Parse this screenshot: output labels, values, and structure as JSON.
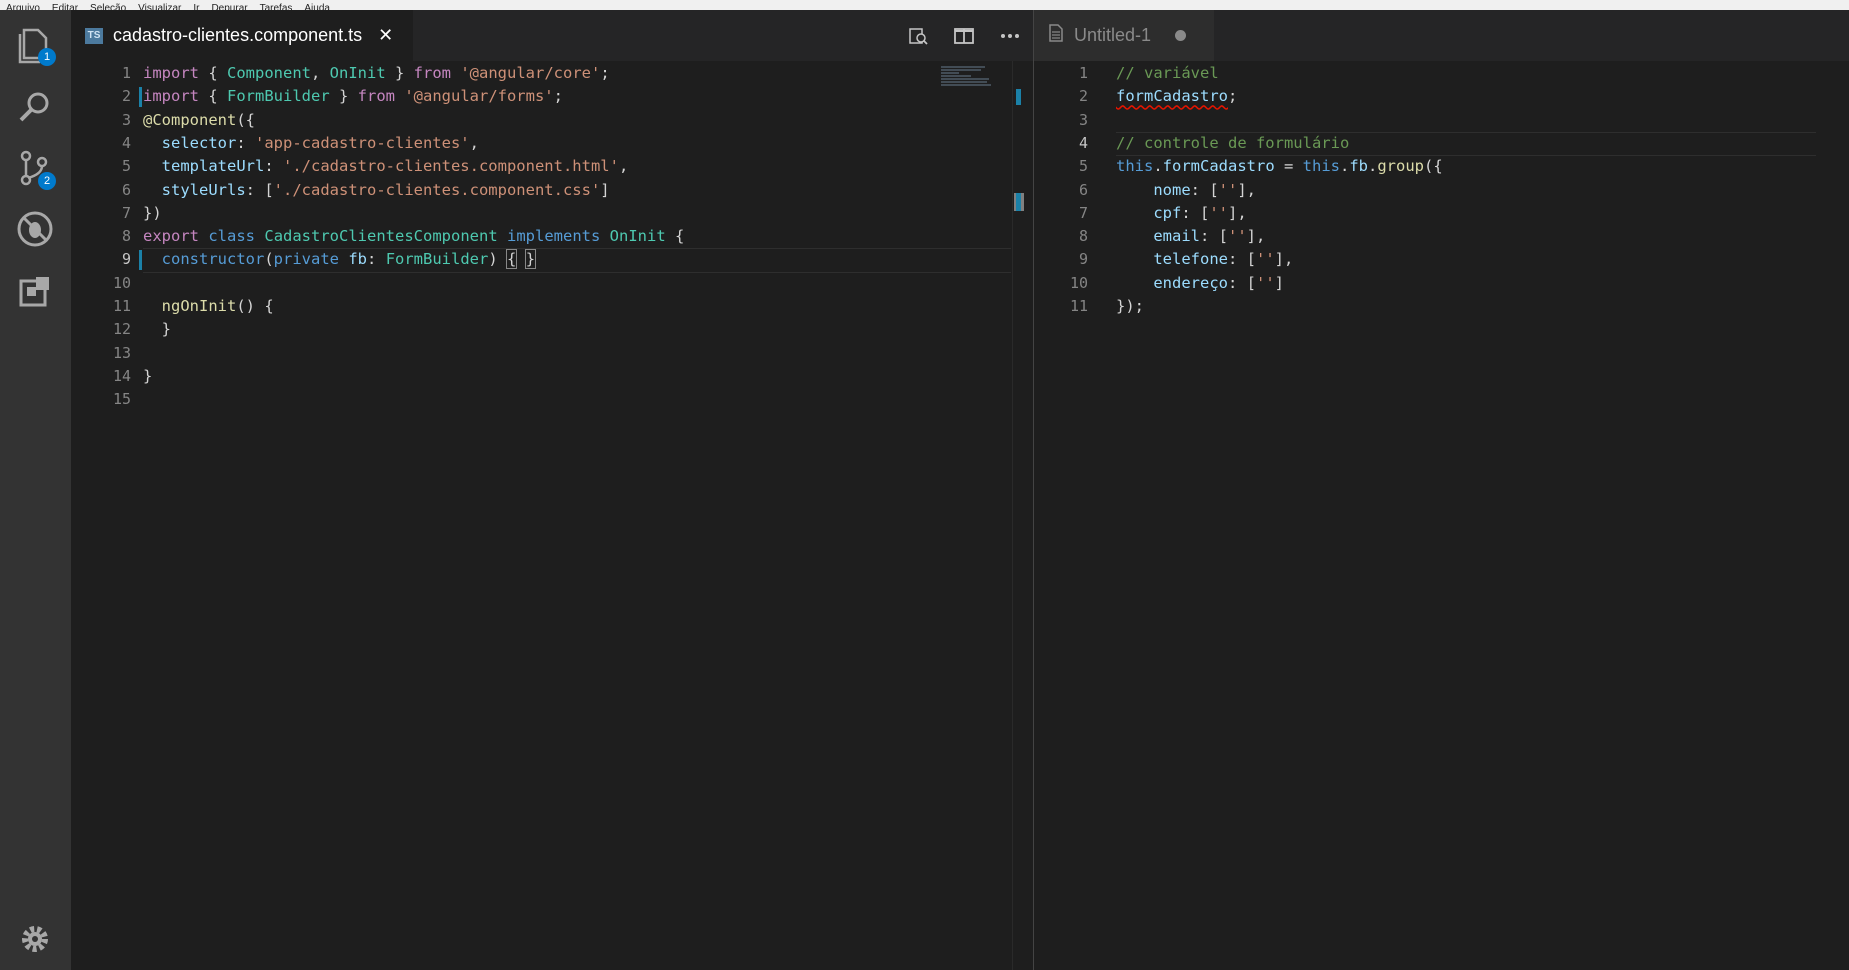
{
  "menubar": {
    "items": [
      "Arquivo",
      "Editar",
      "Seleção",
      "Visualizar",
      "Ir",
      "Depurar",
      "Tarefas",
      "Ajuda"
    ]
  },
  "activity_bar": {
    "items": [
      {
        "name": "explorer-icon",
        "badge": "1"
      },
      {
        "name": "search-icon",
        "badge": ""
      },
      {
        "name": "source-control-icon",
        "badge": "2"
      },
      {
        "name": "debug-icon",
        "badge": ""
      },
      {
        "name": "extensions-icon",
        "badge": ""
      }
    ],
    "settings_icon": "gear-icon"
  },
  "left_editor": {
    "tab": {
      "label": "cadastro-clientes.component.ts",
      "icon_text": "TS",
      "close_glyph": "✕"
    },
    "actions": [
      "open-changes-icon",
      "split-editor-icon",
      "more-actions-icon"
    ],
    "active_line": 9,
    "lines": [
      {
        "n": "1",
        "tokens": [
          [
            "kw",
            "import"
          ],
          [
            "punc",
            " { "
          ],
          [
            "type",
            "Component"
          ],
          [
            "punc",
            ", "
          ],
          [
            "type",
            "OnInit"
          ],
          [
            "punc",
            " } "
          ],
          [
            "kw",
            "from"
          ],
          [
            "punc",
            " "
          ],
          [
            "str",
            "'@angular/core'"
          ],
          [
            "punc",
            ";"
          ]
        ]
      },
      {
        "n": "2",
        "tokens": [
          [
            "kw",
            "import"
          ],
          [
            "punc",
            " { "
          ],
          [
            "type",
            "FormBuilder"
          ],
          [
            "punc",
            " } "
          ],
          [
            "kw",
            "from"
          ],
          [
            "punc",
            " "
          ],
          [
            "str",
            "'@angular/forms'"
          ],
          [
            "punc",
            ";"
          ]
        ]
      },
      {
        "n": "3",
        "tokens": [
          [
            "fn",
            "@Component"
          ],
          [
            "punc",
            "({"
          ]
        ]
      },
      {
        "n": "4",
        "tokens": [
          [
            "punc",
            "  "
          ],
          [
            "prop",
            "selector"
          ],
          [
            "punc",
            ": "
          ],
          [
            "str",
            "'app-cadastro-clientes'"
          ],
          [
            "punc",
            ","
          ]
        ]
      },
      {
        "n": "5",
        "tokens": [
          [
            "punc",
            "  "
          ],
          [
            "prop",
            "templateUrl"
          ],
          [
            "punc",
            ": "
          ],
          [
            "str",
            "'./cadastro-clientes.component.html'"
          ],
          [
            "punc",
            ","
          ]
        ]
      },
      {
        "n": "6",
        "tokens": [
          [
            "punc",
            "  "
          ],
          [
            "prop",
            "styleUrls"
          ],
          [
            "punc",
            ": ["
          ],
          [
            "str",
            "'./cadastro-clientes.component.css'"
          ],
          [
            "punc",
            "]"
          ]
        ]
      },
      {
        "n": "7",
        "tokens": [
          [
            "punc",
            "})"
          ]
        ]
      },
      {
        "n": "8",
        "tokens": [
          [
            "kw",
            "export"
          ],
          [
            "punc",
            " "
          ],
          [
            "blue",
            "class"
          ],
          [
            "punc",
            " "
          ],
          [
            "type",
            "CadastroClientesComponent"
          ],
          [
            "punc",
            " "
          ],
          [
            "blue",
            "implements"
          ],
          [
            "punc",
            " "
          ],
          [
            "type",
            "OnInit"
          ],
          [
            "punc",
            " {"
          ]
        ]
      },
      {
        "n": "9",
        "tokens": [
          [
            "punc",
            "  "
          ],
          [
            "blue",
            "constructor"
          ],
          [
            "punc",
            "("
          ],
          [
            "blue",
            "private"
          ],
          [
            "punc",
            " "
          ],
          [
            "prop",
            "fb"
          ],
          [
            "punc",
            ": "
          ],
          [
            "type",
            "FormBuilder"
          ],
          [
            "punc",
            ") "
          ],
          [
            "bracket",
            "{"
          ],
          [
            "punc",
            " "
          ],
          [
            "bracket",
            "}"
          ]
        ]
      },
      {
        "n": "10",
        "tokens": []
      },
      {
        "n": "11",
        "tokens": [
          [
            "punc",
            "  "
          ],
          [
            "fn",
            "ngOnInit"
          ],
          [
            "punc",
            "() {"
          ]
        ]
      },
      {
        "n": "12",
        "tokens": [
          [
            "punc",
            "  }"
          ]
        ]
      },
      {
        "n": "13",
        "tokens": []
      },
      {
        "n": "14",
        "tokens": [
          [
            "punc",
            "}"
          ]
        ]
      },
      {
        "n": "15",
        "tokens": []
      }
    ]
  },
  "right_editor": {
    "tab": {
      "label": "Untitled-1"
    },
    "active_line": 4,
    "lines": [
      {
        "n": "1",
        "tokens": [
          [
            "cmt",
            "// variável"
          ]
        ]
      },
      {
        "n": "2",
        "tokens": [
          [
            "prop_sq",
            "formCadastro"
          ],
          [
            "punc",
            ";"
          ]
        ]
      },
      {
        "n": "3",
        "tokens": []
      },
      {
        "n": "4",
        "tokens": [
          [
            "cmt",
            "// controle de formulário"
          ]
        ]
      },
      {
        "n": "5",
        "tokens": [
          [
            "blue",
            "this"
          ],
          [
            "punc",
            "."
          ],
          [
            "prop",
            "formCadastro"
          ],
          [
            "punc",
            " = "
          ],
          [
            "blue",
            "this"
          ],
          [
            "punc",
            "."
          ],
          [
            "prop",
            "fb"
          ],
          [
            "punc",
            "."
          ],
          [
            "fn",
            "group"
          ],
          [
            "punc",
            "({"
          ]
        ]
      },
      {
        "n": "6",
        "tokens": [
          [
            "punc",
            "    "
          ],
          [
            "prop",
            "nome"
          ],
          [
            "punc",
            ": ["
          ],
          [
            "str",
            "''"
          ],
          [
            "punc",
            "],"
          ]
        ]
      },
      {
        "n": "7",
        "tokens": [
          [
            "punc",
            "    "
          ],
          [
            "prop",
            "cpf"
          ],
          [
            "punc",
            ": ["
          ],
          [
            "str",
            "''"
          ],
          [
            "punc",
            "],"
          ]
        ]
      },
      {
        "n": "8",
        "tokens": [
          [
            "punc",
            "    "
          ],
          [
            "prop",
            "email"
          ],
          [
            "punc",
            ": ["
          ],
          [
            "str",
            "''"
          ],
          [
            "punc",
            "],"
          ]
        ]
      },
      {
        "n": "9",
        "tokens": [
          [
            "punc",
            "    "
          ],
          [
            "prop",
            "telefone"
          ],
          [
            "punc",
            ": ["
          ],
          [
            "str",
            "''"
          ],
          [
            "punc",
            "],"
          ]
        ]
      },
      {
        "n": "10",
        "tokens": [
          [
            "punc",
            "    "
          ],
          [
            "prop",
            "endereço"
          ],
          [
            "punc",
            ": ["
          ],
          [
            "str",
            "''"
          ],
          [
            "punc",
            "]"
          ]
        ]
      },
      {
        "n": "11",
        "tokens": [
          [
            "punc",
            "});"
          ]
        ]
      }
    ]
  },
  "colors": {
    "accent": "#007acc",
    "gutter_modified": "#1b81a8",
    "keyword": "#c586c0",
    "string": "#ce9178",
    "type": "#4ec9b0",
    "comment": "#6a9955"
  }
}
